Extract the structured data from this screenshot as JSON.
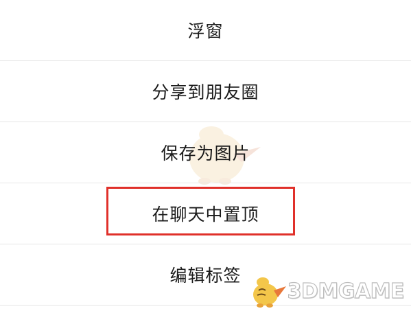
{
  "menu": {
    "items": [
      {
        "label": "浮窗"
      },
      {
        "label": "分享到朋友圈"
      },
      {
        "label": "保存为图片"
      },
      {
        "label": "在聊天中置顶"
      },
      {
        "label": "编辑标签"
      }
    ]
  },
  "watermark": {
    "text": "3DMGAME"
  },
  "colors": {
    "highlight_border": "#e0302a",
    "divider": "#e6e6e6",
    "text": "#1a1a1a"
  },
  "icons": {
    "background_mascot": "chick-mascot-icon",
    "watermark_logo": "3dm-chick-logo-icon"
  }
}
